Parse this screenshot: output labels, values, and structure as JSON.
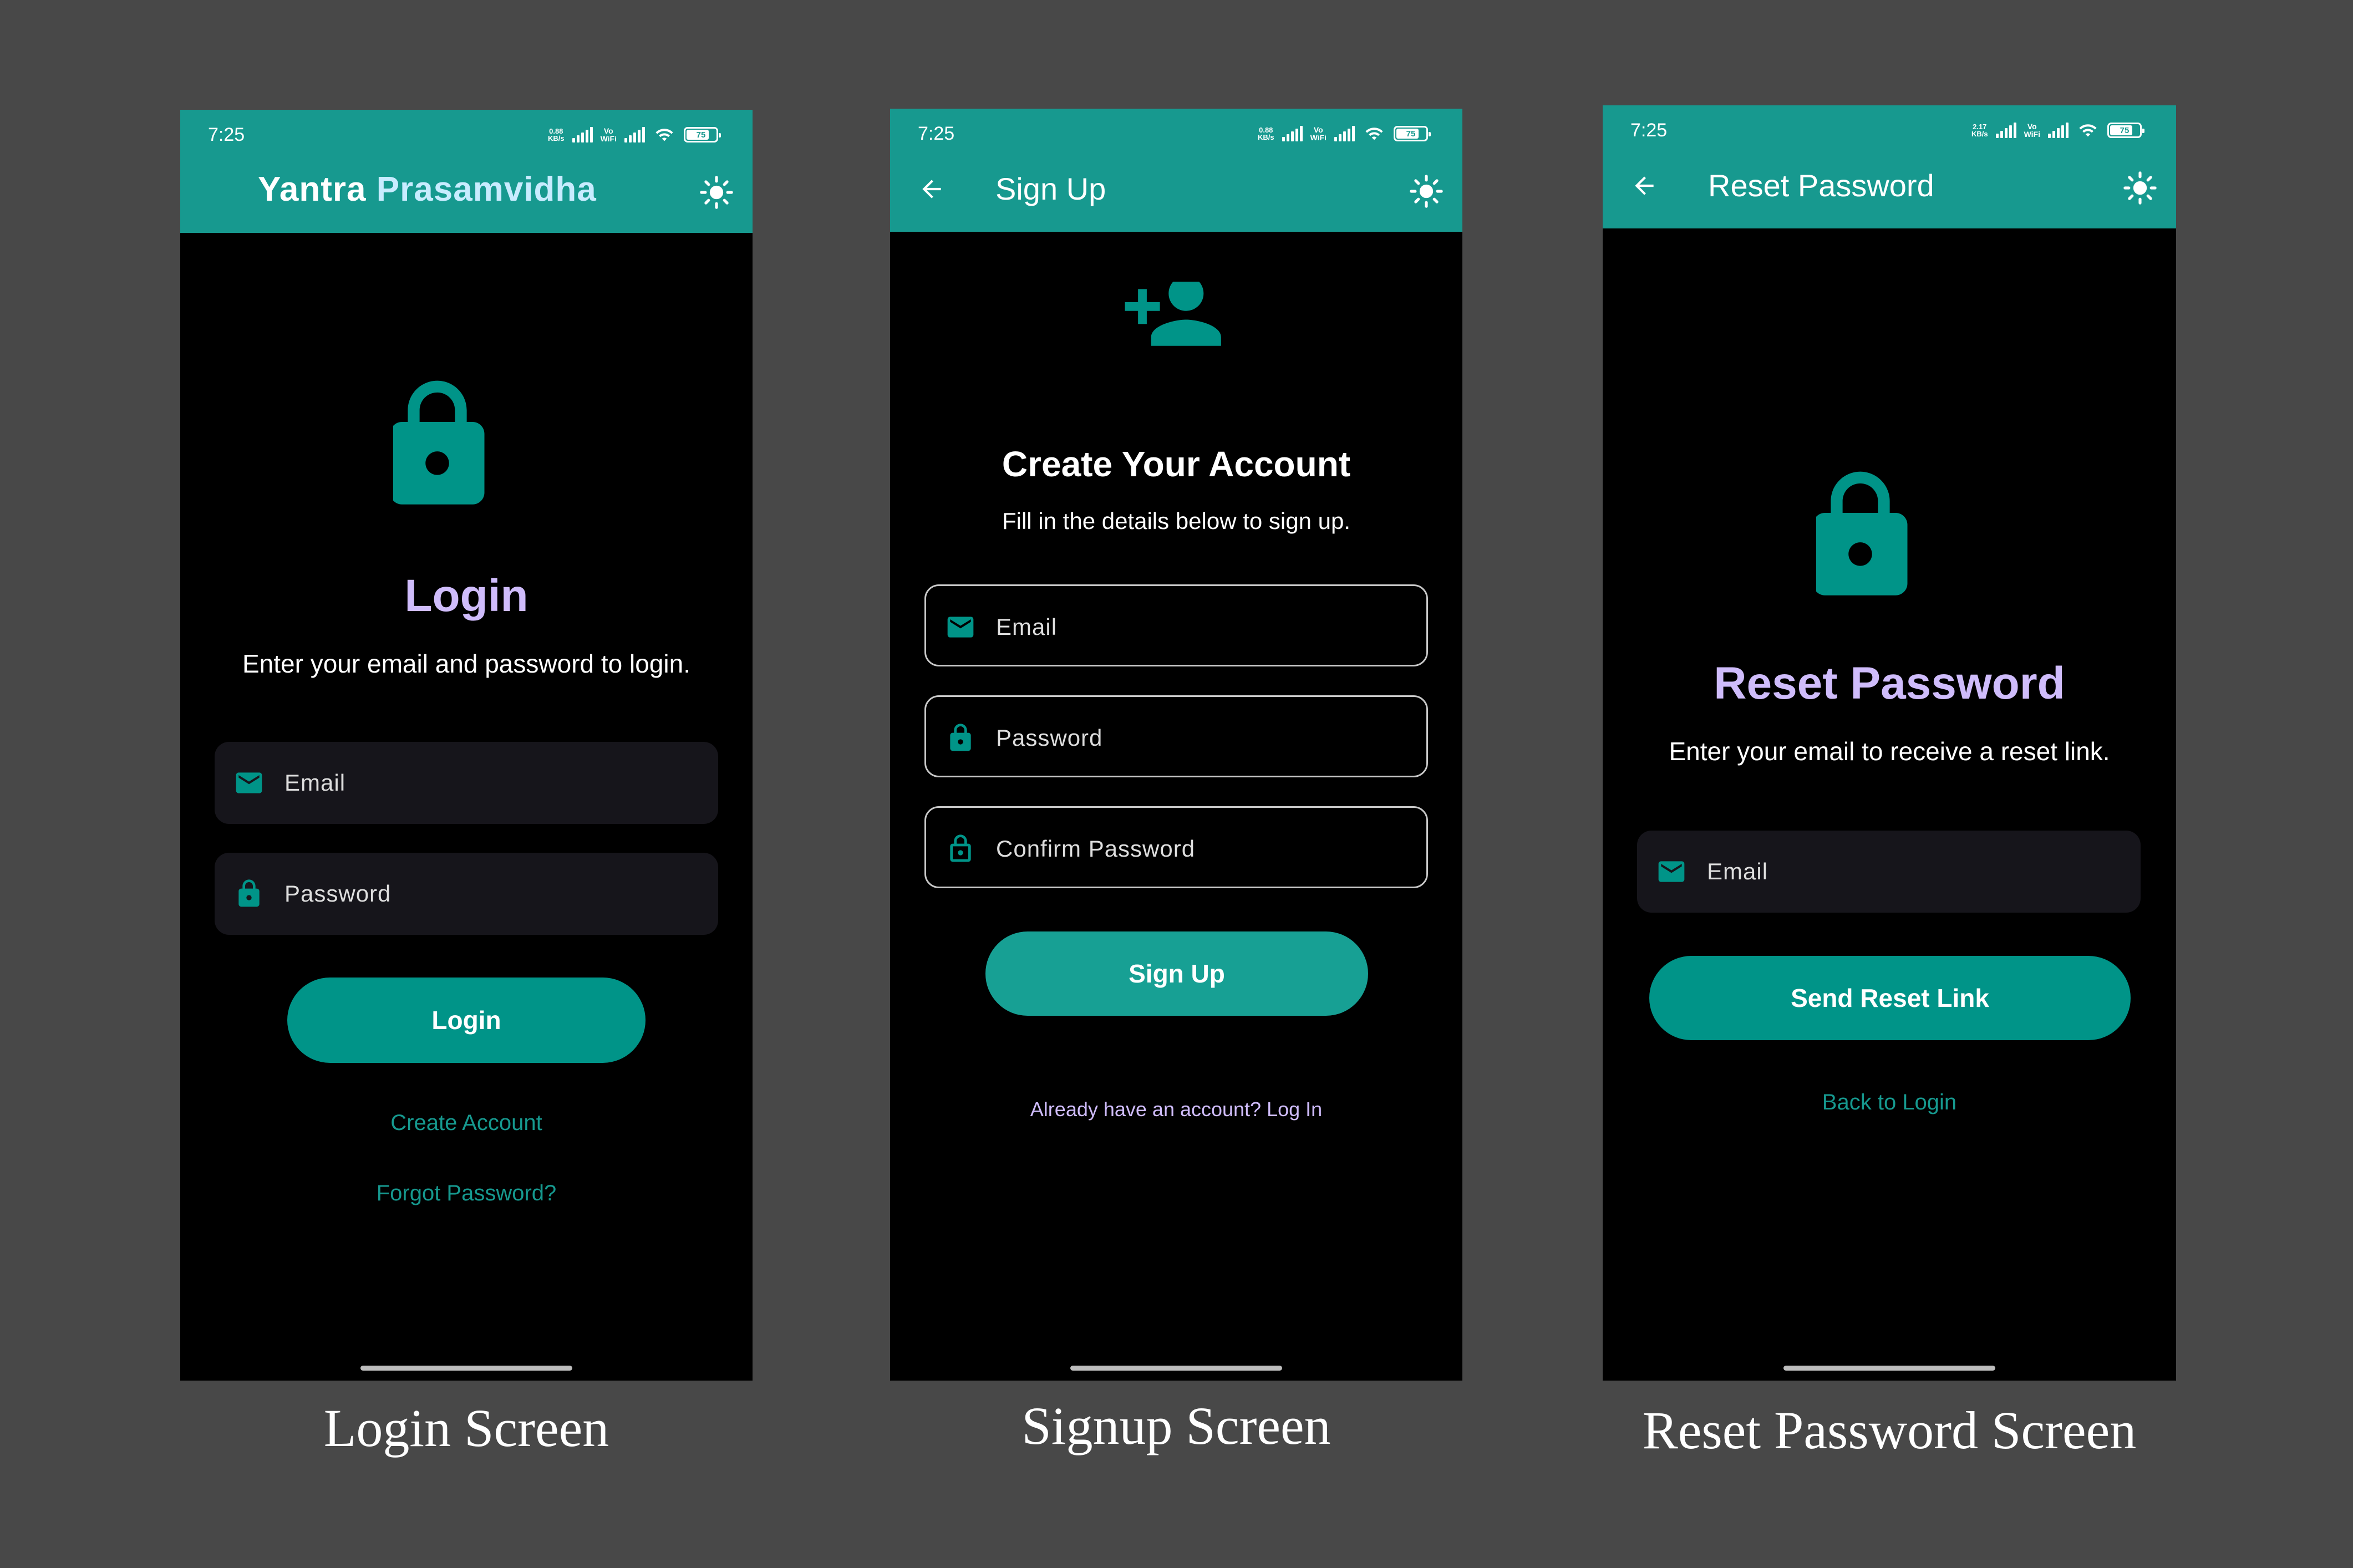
{
  "colors": {
    "background": "#484848",
    "appbar": "#17998f",
    "accent": "#009488",
    "heading_purple": "#cfbcfb",
    "link_teal": "#16998f",
    "link_purple": "#cfbcfb",
    "field_fill": "#16151b"
  },
  "status_bar": {
    "time": "7:25",
    "net_speed_1": "0.88\nKB/s",
    "net_speed_3": "2.17\nKB/s",
    "vowifi": "Vo\nWiFi",
    "battery": "75",
    "icons": [
      "signal-icon",
      "wifi-icon",
      "battery-icon"
    ]
  },
  "login": {
    "app_title_part1": "Yantra",
    "app_title_part2": "Prasamvidha",
    "theme_icon": "sun-icon",
    "hero_icon": "lock-icon",
    "heading": "Login",
    "subtext": "Enter your email and password to login.",
    "email_label": "Email",
    "email_icon": "mail-icon",
    "password_label": "Password",
    "password_icon": "lock-icon",
    "button": "Login",
    "link_create": "Create Account",
    "link_forgot": "Forgot Password?",
    "caption": "Login Screen"
  },
  "signup": {
    "title": "Sign Up",
    "back_icon": "arrow-left-icon",
    "theme_icon": "sun-icon",
    "hero_icon": "person-add-icon",
    "heading": "Create Your Account",
    "subtext": "Fill in the details below to sign up.",
    "email_label": "Email",
    "password_label": "Password",
    "confirm_label": "Confirm Password",
    "button": "Sign Up",
    "link_login": "Already have an account? Log In",
    "caption": "Signup Screen"
  },
  "reset": {
    "title": "Reset Password",
    "back_icon": "arrow-left-icon",
    "theme_icon": "sun-icon",
    "hero_icon": "lock-icon",
    "heading": "Reset Password",
    "subtext": "Enter your email to receive a reset link.",
    "email_label": "Email",
    "button": "Send Reset Link",
    "link_back": "Back to Login",
    "caption": "Reset Password Screen"
  }
}
